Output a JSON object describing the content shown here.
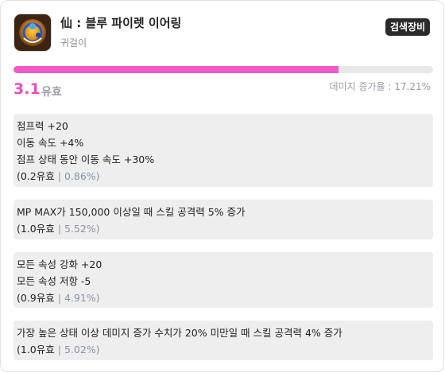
{
  "header": {
    "item_name": "仙 : 블루 파이렛 이어링",
    "item_type": "귀걸이",
    "search_button_label": "검색장비",
    "item_icon": "blue-earring-icon"
  },
  "score": {
    "value": "3.1",
    "unit": "유효",
    "progress_fraction": 0.775,
    "damage_increase_text": "데미지 증가율 : 17.21%"
  },
  "colors": {
    "accent": "#e84fc0",
    "progress": "#f05ac8",
    "muted": "#9a9aa6",
    "option_bg": "#eeeeee"
  },
  "options": [
    {
      "stats": [
        "점프력 +20",
        "이동 속도 +4%",
        "점프 상태 동안 이동 속도 +30%"
      ],
      "effective": "(0.2유효",
      "separator": " | ",
      "percent": "0.86%)"
    },
    {
      "stats": [
        "MP MAX가 150,000 이상일 때 스킬 공격력 5% 증가"
      ],
      "effective": "(1.0유효",
      "separator": " | ",
      "percent": "5.52%)"
    },
    {
      "stats": [
        "모든 속성 강화 +20",
        "모든 속성 저항 -5"
      ],
      "effective": "(0.9유효",
      "separator": " | ",
      "percent": "4.91%)"
    },
    {
      "stats": [
        "가장 높은 상태 이상 데미지 증가 수치가 20% 미만일 때 스킬 공격력 4% 증가"
      ],
      "effective": "(1.0유효",
      "separator": " | ",
      "percent": "5.02%)"
    }
  ]
}
